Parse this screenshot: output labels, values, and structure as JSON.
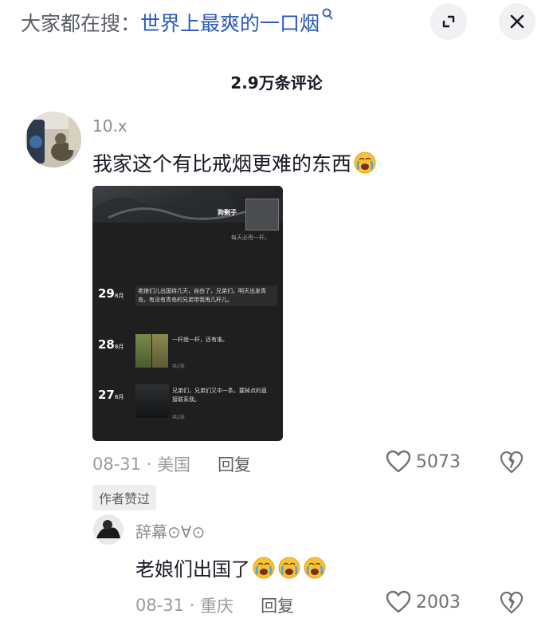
{
  "search": {
    "prefix": "大家都在搜：",
    "term": "世界上最爽的一口烟",
    "q_mark": "Q"
  },
  "header": {
    "comment_count": "2.9万条评论"
  },
  "comments": [
    {
      "author": "10.x",
      "text": "我家这个有比戒烟更难的东西",
      "emoji": "crying-face",
      "image": {
        "profile_name": "狗剩子",
        "signature": "每天必甩一杆。",
        "entries": [
          {
            "day": "29",
            "month": "8月",
            "text": "老娘们儿出国待几天，自由了，兄弟们，明天出发青岛，有没有青岛的兄弟带我甩几杆儿。"
          },
          {
            "day": "28",
            "month": "8月",
            "text": "一杆就一杆，还有谁。",
            "photos": "共2张"
          },
          {
            "day": "27",
            "month": "8月",
            "text": "兄弟们，兄弟们又中一条，要掉点的直接联系我。",
            "photos": "共2张"
          }
        ]
      },
      "date": "08-31",
      "location": "美国",
      "reply_label": "回复",
      "likes": "5073",
      "badge": "作者赞过"
    },
    {
      "author": "辞幕⊙∀⊙",
      "text": "老娘们出国了",
      "emoji": "crying-face x3",
      "date": "08-31",
      "location": "重庆",
      "reply_label": "回复",
      "likes": "2003"
    }
  ],
  "colors": {
    "link": "#2a5bb8",
    "meta": "#9a9ba0",
    "text": "#161823",
    "emoji": "#f7c234"
  }
}
